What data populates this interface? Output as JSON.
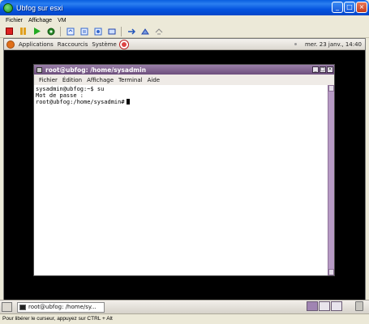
{
  "outer_window": {
    "title": "Ubfog sur esxi",
    "menu": [
      "Fichier",
      "Affichage",
      "VM"
    ],
    "status_text": "Pour libérer le curseur, appuyez sur CTRL + Alt"
  },
  "toolbar": {
    "icons": [
      "power-off-icon",
      "pause-icon",
      "play-icon",
      "reset-icon",
      "snapshot-icon",
      "revert-snapshot-icon",
      "manage-snapshots-icon",
      "connect-device-icon",
      "network-icon",
      "settings-icon"
    ]
  },
  "gnome_panel": {
    "menus": [
      "Applications",
      "Raccourcis",
      "Système"
    ],
    "clock": "mer. 23 janv., 14:40"
  },
  "terminal": {
    "title": "root@ubfog: /home/sysadmin",
    "menu": [
      "Fichier",
      "Édition",
      "Affichage",
      "Terminal",
      "Aide"
    ],
    "lines": [
      "sysadmin@ubfog:~$ su",
      "Mot de passe :",
      "root@ubfog:/home/sysadmin#"
    ]
  },
  "taskbar": {
    "terminal_label": "root@ubfog: /home/sy..."
  },
  "colors": {
    "xp_title_blue": "#0554e0",
    "terminal_title_purple": "#6d4f7d",
    "scrollbar_purple": "#b69ac4"
  }
}
